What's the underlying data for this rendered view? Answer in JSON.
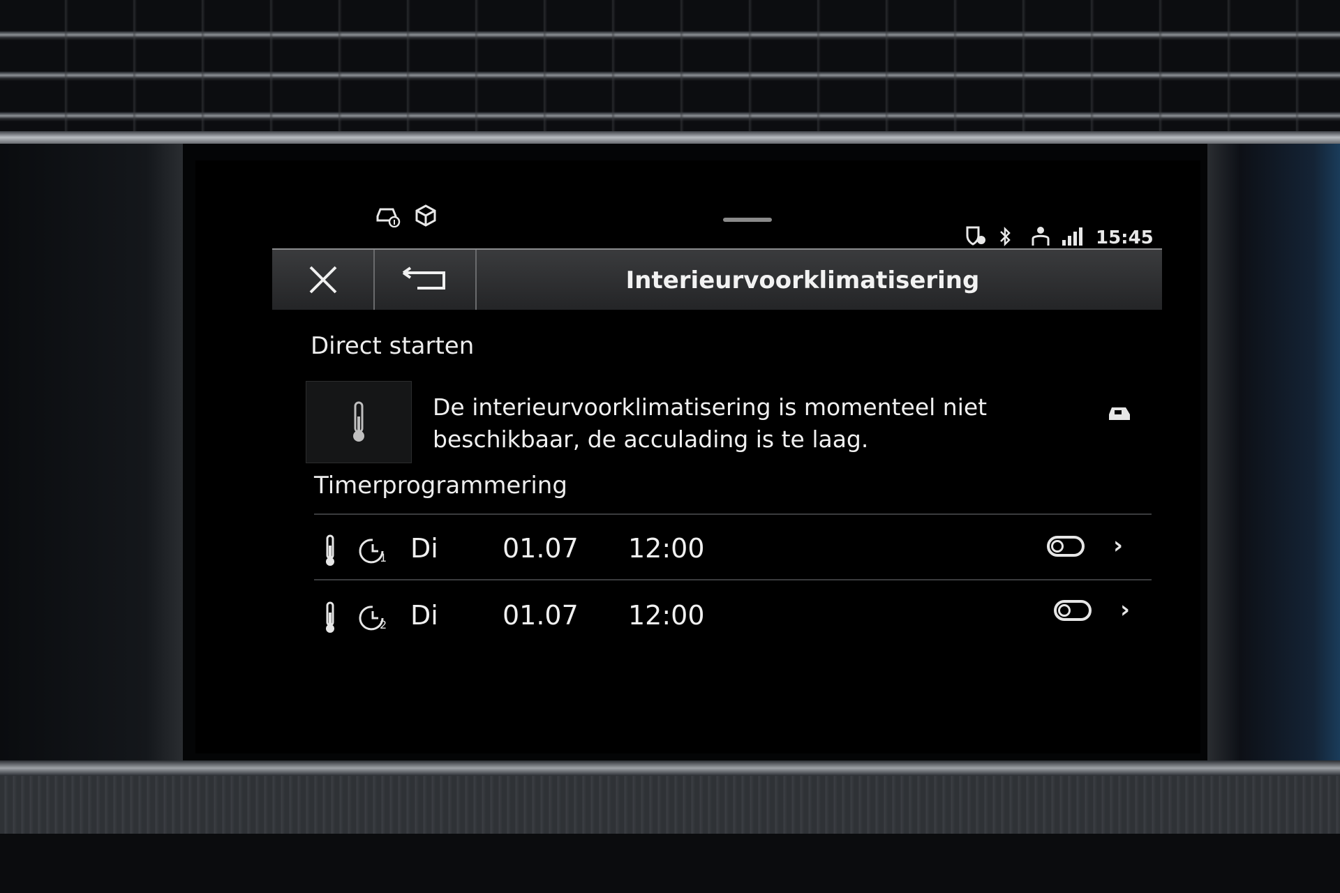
{
  "statusbar": {
    "left_icons": [
      "car-info-icon",
      "package-icon"
    ],
    "right_icons": [
      "location-shield-icon",
      "bluetooth-icon",
      "person-icon",
      "signal-icon"
    ],
    "time": "15:45"
  },
  "dialog": {
    "title": "Interieurvoorklimatisering",
    "close_icon": "close-icon",
    "back_icon": "back-arrow-icon"
  },
  "direct_start": {
    "label": "Direct starten",
    "icon": "thermometer-icon",
    "message_line1": "De interieurvoorklimatisering is momenteel niet",
    "message_line2": "beschikbaar, de acculading is te laag.",
    "status_icon": "car-charging-icon"
  },
  "timer": {
    "label": "Timerprogrammering",
    "rows": [
      {
        "timer_index": "1",
        "day": "Di",
        "date": "01.07",
        "time": "12:00",
        "enabled": false
      },
      {
        "timer_index": "2",
        "day": "Di",
        "date": "01.07",
        "time": "12:00",
        "enabled": false
      }
    ]
  },
  "colors": {
    "screen_bg": "#000000",
    "text": "#f0f0f0",
    "header_bg": "#2e2f31"
  }
}
